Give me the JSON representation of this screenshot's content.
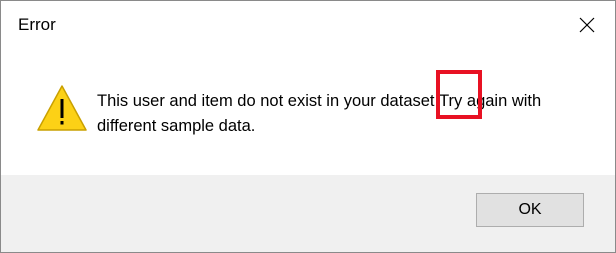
{
  "dialog": {
    "title": "Error",
    "close_icon": "close-icon",
    "warning_icon": "warning-icon",
    "message": "This user and item do not exist in your dataset.Try again with different sample data.",
    "ok_label": "OK"
  },
  "colors": {
    "highlight": "#e81123",
    "warning_fill": "#fcd116",
    "footer_bg": "#f0f0f0",
    "button_bg": "#e1e1e1"
  }
}
